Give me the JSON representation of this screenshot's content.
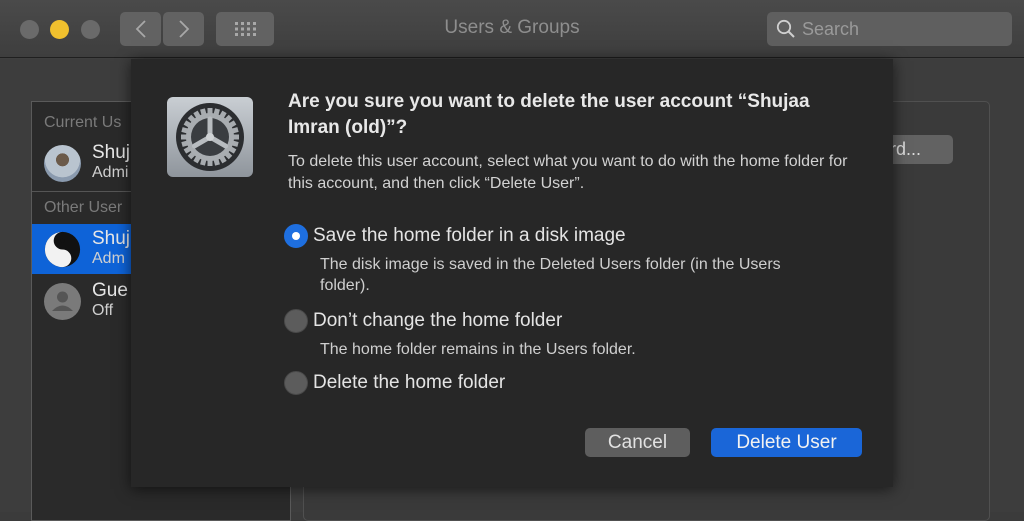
{
  "window": {
    "title": "Users & Groups",
    "search_placeholder": "Search"
  },
  "sidebar": {
    "current_header": "Current Us",
    "other_header": "Other User",
    "users": [
      {
        "name": "Shuj",
        "role": "Admi",
        "section": "current",
        "avatar": "photo",
        "selected": false
      },
      {
        "name": "Shuj",
        "role": "Adm",
        "section": "other",
        "avatar": "yin-yang",
        "selected": true
      },
      {
        "name": "Gue",
        "role": "Off",
        "section": "other",
        "avatar": "generic-person",
        "selected": false
      }
    ]
  },
  "right_panel": {
    "password_button": "ord..."
  },
  "dialog": {
    "icon": "system-preferences-gear-icon",
    "heading": "Are you sure you want to delete the user account “Shujaa Imran (old)”?",
    "description": "To delete this user account, select what you want to do with the home folder for this account, and then click “Delete User”.",
    "options": [
      {
        "label": "Save the home folder in a disk image",
        "detail": "The disk image is saved in the Deleted Users folder (in the Users folder).",
        "checked": true
      },
      {
        "label": "Don’t change the home folder",
        "detail": "The home folder remains in the Users folder.",
        "checked": false
      },
      {
        "label": "Delete the home folder",
        "detail": "",
        "checked": false
      }
    ],
    "cancel_label": "Cancel",
    "confirm_label": "Delete User"
  },
  "colors": {
    "accent": "#1a66d8",
    "selection": "#0e63d8",
    "minimize": "#f0c02e"
  }
}
